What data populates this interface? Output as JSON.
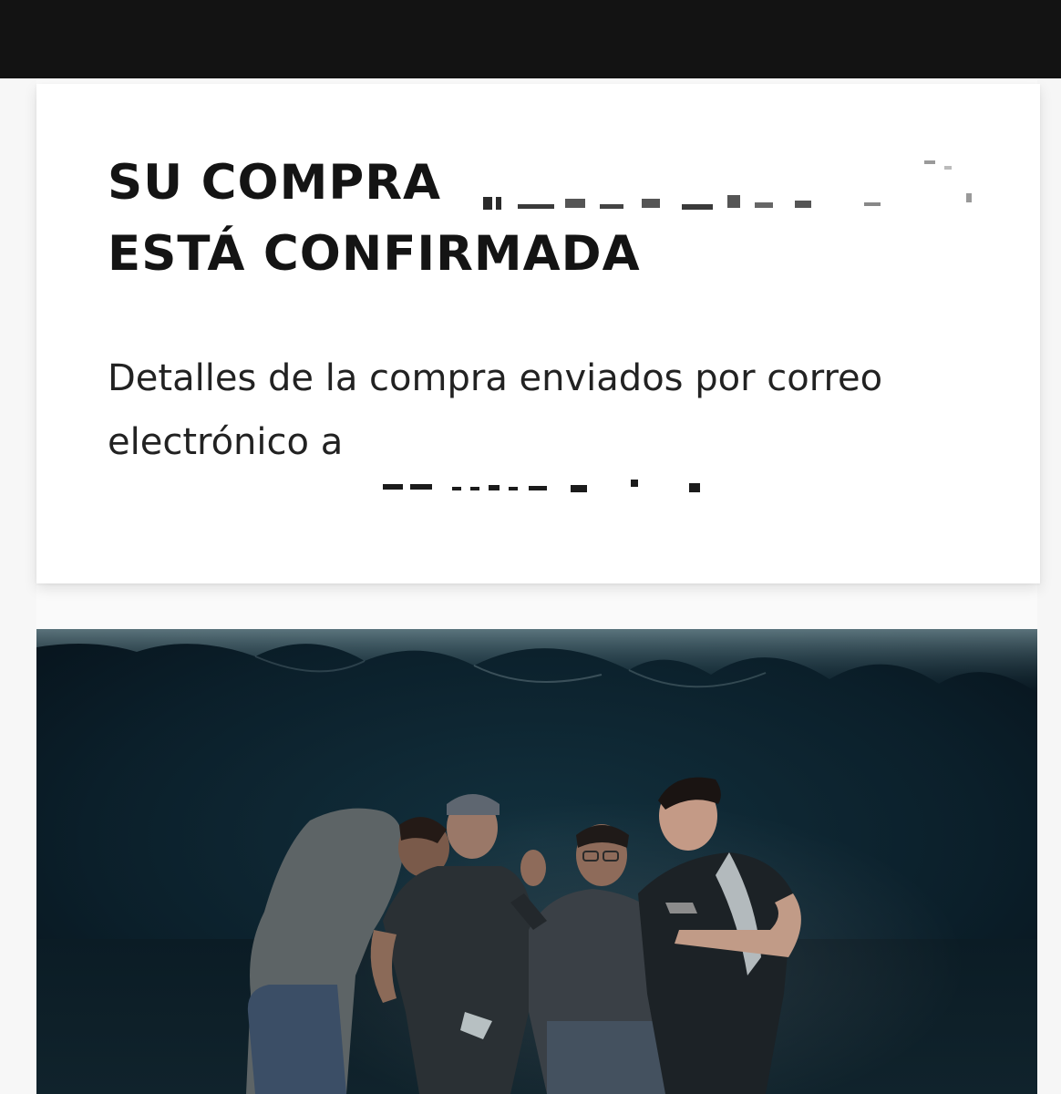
{
  "confirmation": {
    "title_line1": "SU COMPRA",
    "title_line2": "ESTÁ CONFIRMADA",
    "description": "Detalles de la compra enviados por correo electrónico a"
  },
  "photo": {
    "subject": "group-photo"
  }
}
